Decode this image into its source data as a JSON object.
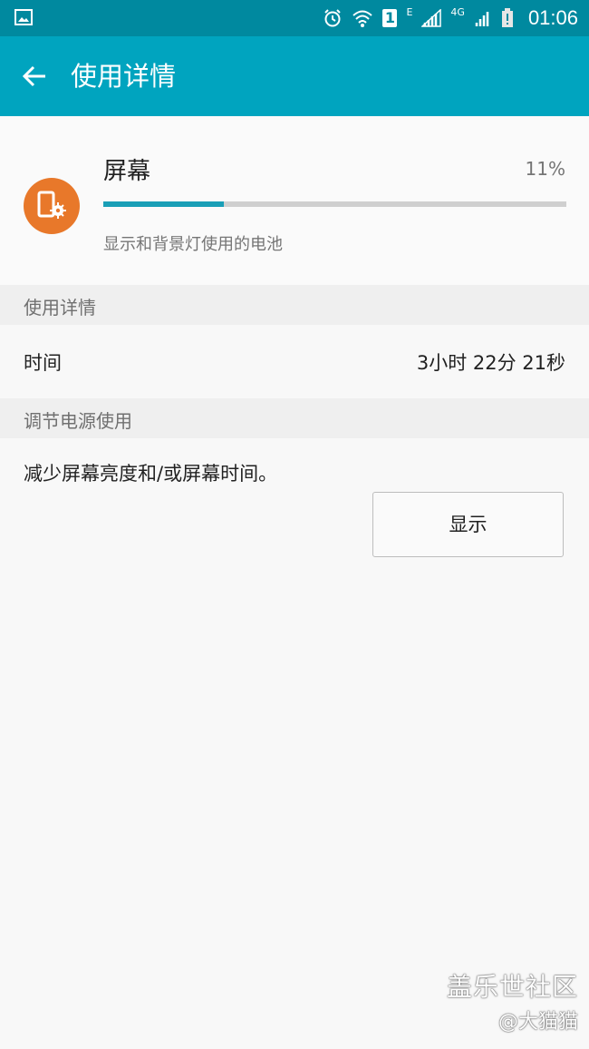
{
  "status_bar": {
    "time": "01:06",
    "network_labels": [
      "E",
      "4G"
    ],
    "sim_label": "1",
    "icons": [
      "gallery-icon",
      "alarm-icon",
      "wifi-icon",
      "signal-icon",
      "battery-alert-icon"
    ]
  },
  "app_bar": {
    "title": "使用详情",
    "back_icon": "arrow-left-icon"
  },
  "item": {
    "title": "屏幕",
    "percent": "11%",
    "usage_fraction": 0.26,
    "description": "显示和背景灯使用的电池",
    "icon": "screen-settings-icon",
    "icon_color": "#e8782a"
  },
  "usage_details": {
    "header": "使用详情",
    "time_label": "时间",
    "time_value": "3小时 22分 21秒"
  },
  "power_saving": {
    "header": "调节电源使用",
    "tip": "减少屏幕亮度和/或屏幕时间。",
    "button_label": "显示"
  },
  "watermark": {
    "line1": "盖乐世社区",
    "line2": "@大猫猫"
  },
  "colors": {
    "status_bar": "#00899f",
    "app_bar": "#00a4bf",
    "progress": "#1a9fb7"
  }
}
